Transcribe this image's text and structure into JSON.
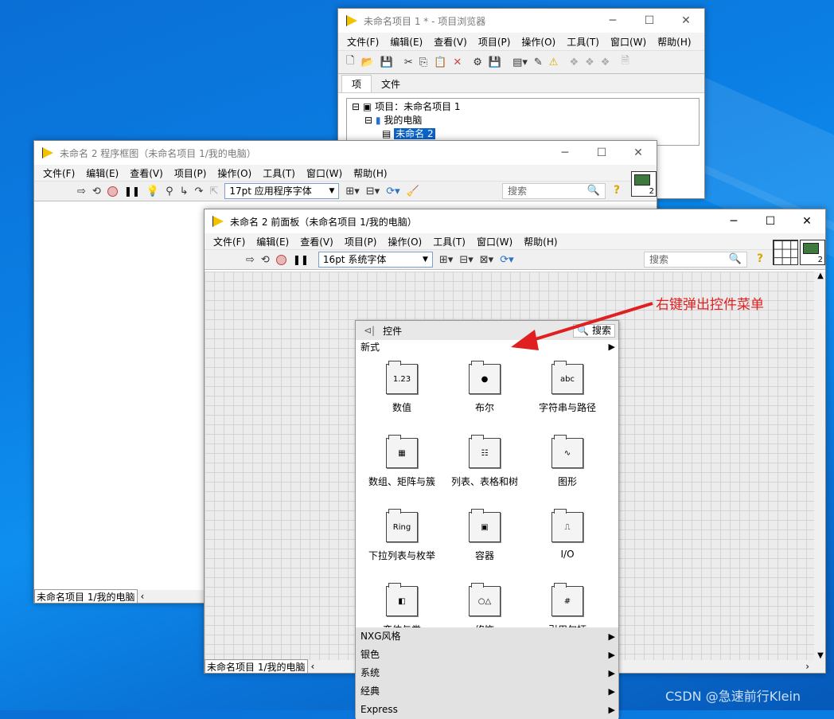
{
  "project_window": {
    "title": "未命名项目 1 * - 项目浏览器",
    "menu": [
      "文件(F)",
      "编辑(E)",
      "查看(V)",
      "项目(P)",
      "操作(O)",
      "工具(T)",
      "窗口(W)",
      "帮助(H)"
    ],
    "tabs": [
      "项",
      "文件"
    ],
    "tree": [
      "项目：未命名项目 1",
      "我的电脑",
      "未命名 2"
    ]
  },
  "block_diagram": {
    "title": "未命名 2 程序框图（未命名项目 1/我的电脑）",
    "menu": [
      "文件(F)",
      "编辑(E)",
      "查看(V)",
      "项目(P)",
      "操作(O)",
      "工具(T)",
      "窗口(W)",
      "帮助(H)"
    ],
    "font": "17pt 应用程序字体",
    "search_placeholder": "搜索",
    "status": "未命名项目 1/我的电脑",
    "connector_number": "2"
  },
  "front_panel": {
    "title": "未命名 2 前面板（未命名项目 1/我的电脑）",
    "menu": [
      "文件(F)",
      "编辑(E)",
      "查看(V)",
      "项目(P)",
      "操作(O)",
      "工具(T)",
      "窗口(W)",
      "帮助(H)"
    ],
    "font": "16pt 系统字体",
    "search_placeholder": "搜索",
    "status": "未命名项目 1/我的电脑",
    "connector_number": "2"
  },
  "palette": {
    "title": "控件",
    "search": "搜索",
    "category": "新式",
    "items": [
      {
        "label": "数值",
        "icon": "numeric-icon",
        "glyph": "1.23"
      },
      {
        "label": "布尔",
        "icon": "boolean-icon",
        "glyph": "●"
      },
      {
        "label": "字符串与路径",
        "icon": "string-path-icon",
        "glyph": "abc"
      },
      {
        "label": "数组、矩阵与簇",
        "icon": "array-matrix-cluster-icon",
        "glyph": "▦"
      },
      {
        "label": "列表、表格和树",
        "icon": "list-table-tree-icon",
        "glyph": "☷"
      },
      {
        "label": "图形",
        "icon": "graph-icon",
        "glyph": "∿"
      },
      {
        "label": "下拉列表与枚举",
        "icon": "ring-enum-icon",
        "glyph": "Ring"
      },
      {
        "label": "容器",
        "icon": "container-icon",
        "glyph": "▣"
      },
      {
        "label": "I/O",
        "icon": "io-icon",
        "glyph": "⎍"
      },
      {
        "label": "变体与类",
        "icon": "variant-class-icon",
        "glyph": "◧"
      },
      {
        "label": "修饰",
        "icon": "decoration-icon",
        "glyph": "○△"
      },
      {
        "label": "引用句柄",
        "icon": "refnum-icon",
        "glyph": "#"
      }
    ],
    "sections": [
      "NXG风格",
      "银色",
      "系统",
      "经典",
      "Express"
    ]
  },
  "annotation": "右键弹出控件菜单",
  "watermark": "CSDN @急速前行Klein",
  "colors": {
    "accent": "#0a64c8",
    "annotation": "#e02020",
    "desktop": "#0b7fe4"
  }
}
